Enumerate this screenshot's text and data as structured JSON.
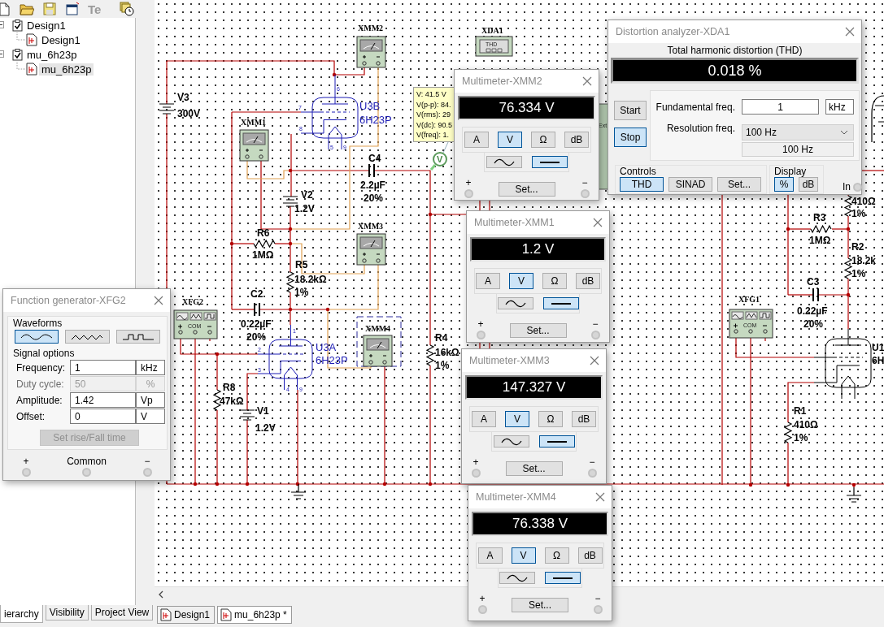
{
  "toolbar": [
    {
      "kind": "new",
      "disabled": false
    },
    {
      "kind": "open",
      "disabled": false
    },
    {
      "kind": "save",
      "disabled": false
    },
    {
      "kind": "window",
      "disabled": false
    },
    {
      "kind": "text",
      "label": "Te",
      "disabled": true
    },
    {
      "kind": "clock",
      "disabled": false
    }
  ],
  "design_tree": [
    {
      "label": "Design1",
      "checked": true,
      "expanded": true,
      "children": [
        {
          "label": "Design1",
          "selected": false
        }
      ]
    },
    {
      "label": "mu_6h23p",
      "checked": true,
      "expanded": true,
      "children": [
        {
          "label": "mu_6h23p",
          "selected": true
        }
      ]
    }
  ],
  "panel_tabs": [
    {
      "label": "ierarchy",
      "selected": true
    },
    {
      "label": "Visibility",
      "selected": false
    },
    {
      "label": "Project View",
      "selected": false
    }
  ],
  "schematic": {
    "labels": [
      {
        "text": "V3",
        "kind": "part"
      },
      {
        "text": "300V",
        "kind": "part"
      },
      {
        "text": "V2",
        "kind": "part"
      },
      {
        "text": "1.2V",
        "kind": "part"
      },
      {
        "text": "C4",
        "kind": "part"
      },
      {
        "text": "2.2µF",
        "kind": "part"
      },
      {
        "text": "20%",
        "kind": "part"
      },
      {
        "text": "R6",
        "kind": "part"
      },
      {
        "text": "1MΩ",
        "kind": "part"
      },
      {
        "text": "R5",
        "kind": "part"
      },
      {
        "text": "18.2kΩ",
        "kind": "part"
      },
      {
        "text": "1%",
        "kind": "part"
      },
      {
        "text": "C2",
        "kind": "part"
      },
      {
        "text": "0.22µF",
        "kind": "part"
      },
      {
        "text": "20%",
        "kind": "part"
      },
      {
        "text": "R8",
        "kind": "part"
      },
      {
        "text": "47kΩ",
        "kind": "part"
      },
      {
        "text": "V1",
        "kind": "part"
      },
      {
        "text": "1.2V",
        "kind": "part"
      },
      {
        "text": "R4",
        "kind": "part"
      },
      {
        "text": "16kΩ",
        "kind": "part"
      },
      {
        "text": "1%",
        "kind": "part"
      },
      {
        "text": "410Ω",
        "kind": "part"
      },
      {
        "text": "1%",
        "kind": "part"
      },
      {
        "text": "R3",
        "kind": "part"
      },
      {
        "text": "1MΩ",
        "kind": "part"
      },
      {
        "text": "R2",
        "kind": "part"
      },
      {
        "text": "18.2k",
        "kind": "part"
      },
      {
        "text": "1%",
        "kind": "part"
      },
      {
        "text": "C3",
        "kind": "part"
      },
      {
        "text": "0.22µF",
        "kind": "part"
      },
      {
        "text": "20%",
        "kind": "part"
      },
      {
        "text": "R1",
        "kind": "part"
      },
      {
        "text": "410Ω",
        "kind": "part"
      },
      {
        "text": "1%",
        "kind": "part"
      },
      {
        "text": "U3B",
        "kind": "tube"
      },
      {
        "text": "6H23P",
        "kind": "tube"
      },
      {
        "text": "U3A",
        "kind": "tube"
      },
      {
        "text": "6H23P",
        "kind": "tube"
      },
      {
        "text": "U1",
        "kind": "part"
      },
      {
        "text": "6H",
        "kind": "part"
      },
      {
        "text": "XMM2",
        "kind": "instrument"
      },
      {
        "text": "XMM1",
        "kind": "instrument"
      },
      {
        "text": "XMM3",
        "kind": "instrument"
      },
      {
        "text": "XFG2",
        "kind": "instrument"
      },
      {
        "text": "XMM4",
        "kind": "instrument"
      },
      {
        "text": "XDA1",
        "kind": "instrument"
      },
      {
        "text": "XFG1",
        "kind": "instrument"
      },
      {
        "text": "6",
        "kind": "pin"
      },
      {
        "text": "7",
        "kind": "pin"
      },
      {
        "text": "8",
        "kind": "pin"
      },
      {
        "text": "5",
        "kind": "pin"
      },
      {
        "text": "9",
        "kind": "pin"
      },
      {
        "text": "1",
        "kind": "pin"
      },
      {
        "text": "2",
        "kind": "pin"
      },
      {
        "text": "3",
        "kind": "pin"
      },
      {
        "text": "4",
        "kind": "pin"
      },
      {
        "text": "9",
        "kind": "pin"
      },
      {
        "text": "COM",
        "kind": "tiny"
      },
      {
        "text": "COM",
        "kind": "tiny"
      },
      {
        "text": "THD",
        "kind": "tiny"
      },
      {
        "text": "Ext",
        "kind": "tiny"
      }
    ],
    "probe": {
      "label": "V",
      "readings": [
        "V: 41.5 V",
        "V(p-p): 84.",
        "V(rms): 29",
        "V(dc): 90.5",
        "V(freq): 1."
      ]
    }
  },
  "function_generator": {
    "title": "Function generator-XFG2",
    "waveforms_label": "Waveforms",
    "waveforms": [
      {
        "kind": "sine",
        "selected": true
      },
      {
        "kind": "triangle",
        "selected": false
      },
      {
        "kind": "square",
        "selected": false
      }
    ],
    "options_label": "Signal options",
    "fields": [
      {
        "label": "Frequency:",
        "value": "1",
        "unit": "kHz",
        "disabled": false
      },
      {
        "label": "Duty cycle:",
        "value": "50",
        "unit": "%",
        "disabled": true
      },
      {
        "label": "Amplitude:",
        "value": "1.42",
        "unit": "Vp",
        "disabled": false
      },
      {
        "label": "Offset:",
        "value": "0",
        "unit": "V",
        "disabled": false
      }
    ],
    "rise_fall_button": {
      "label": "Set rise/Fall time",
      "disabled": true
    },
    "terminals": [
      "+",
      "Common",
      "−"
    ]
  },
  "multimeters": [
    {
      "title": "Multimeter-XMM2",
      "reading": "76.334 V",
      "modes": [
        {
          "label": "A",
          "selected": false
        },
        {
          "label": "V",
          "selected": true
        },
        {
          "label": "Ω",
          "selected": false
        },
        {
          "label": "dB",
          "selected": false
        }
      ],
      "coupling": [
        {
          "kind": "ac",
          "selected": false
        },
        {
          "kind": "dc",
          "selected": true
        }
      ],
      "terminals": [
        "+",
        "−"
      ],
      "set_button": "Set..."
    },
    {
      "title": "Multimeter-XMM1",
      "reading": "1.2 V",
      "modes": [
        {
          "label": "A",
          "selected": false
        },
        {
          "label": "V",
          "selected": true
        },
        {
          "label": "Ω",
          "selected": false
        },
        {
          "label": "dB",
          "selected": false
        }
      ],
      "coupling": [
        {
          "kind": "ac",
          "selected": false
        },
        {
          "kind": "dc",
          "selected": true
        }
      ],
      "terminals": [
        "+",
        "−"
      ],
      "set_button": "Set..."
    },
    {
      "title": "Multimeter-XMM3",
      "reading": "147.327 V",
      "modes": [
        {
          "label": "A",
          "selected": false
        },
        {
          "label": "V",
          "selected": true
        },
        {
          "label": "Ω",
          "selected": false
        },
        {
          "label": "dB",
          "selected": false
        }
      ],
      "coupling": [
        {
          "kind": "ac",
          "selected": false
        },
        {
          "kind": "dc",
          "selected": true
        }
      ],
      "terminals": [
        "+",
        "−"
      ],
      "set_button": "Set..."
    },
    {
      "title": "Multimeter-XMM4",
      "reading": "76.338 V",
      "modes": [
        {
          "label": "A",
          "selected": false
        },
        {
          "label": "V",
          "selected": true
        },
        {
          "label": "Ω",
          "selected": false
        },
        {
          "label": "dB",
          "selected": false
        }
      ],
      "coupling": [
        {
          "kind": "ac",
          "selected": false
        },
        {
          "kind": "dc",
          "selected": true
        }
      ],
      "terminals": [
        "+",
        "−"
      ],
      "set_button": "Set..."
    }
  ],
  "distortion_analyzer": {
    "title": "Distortion analyzer-XDA1",
    "display_caption": "Total harmonic distortion (THD)",
    "reading": "0.018 %",
    "run_buttons": [
      {
        "label": "Start",
        "selected": false
      },
      {
        "label": "Stop",
        "selected": true
      }
    ],
    "fundamental": {
      "label": "Fundamental freq.",
      "value": "1",
      "unit": "kHz"
    },
    "resolution": {
      "label": "Resolution freq.",
      "value": "100 Hz",
      "readout": "100 Hz"
    },
    "controls_label": "Controls",
    "controls": [
      {
        "label": "THD",
        "selected": true
      },
      {
        "label": "SINAD",
        "selected": false
      },
      {
        "label": "Set...",
        "selected": false
      }
    ],
    "display_label": "Display",
    "display": [
      {
        "label": "%",
        "selected": true
      },
      {
        "label": "dB",
        "selected": false
      }
    ],
    "terminal": "In"
  },
  "document_tabs": [
    {
      "label": "Design1",
      "selected": false
    },
    {
      "label": "mu_6h23p *",
      "selected": true
    }
  ]
}
